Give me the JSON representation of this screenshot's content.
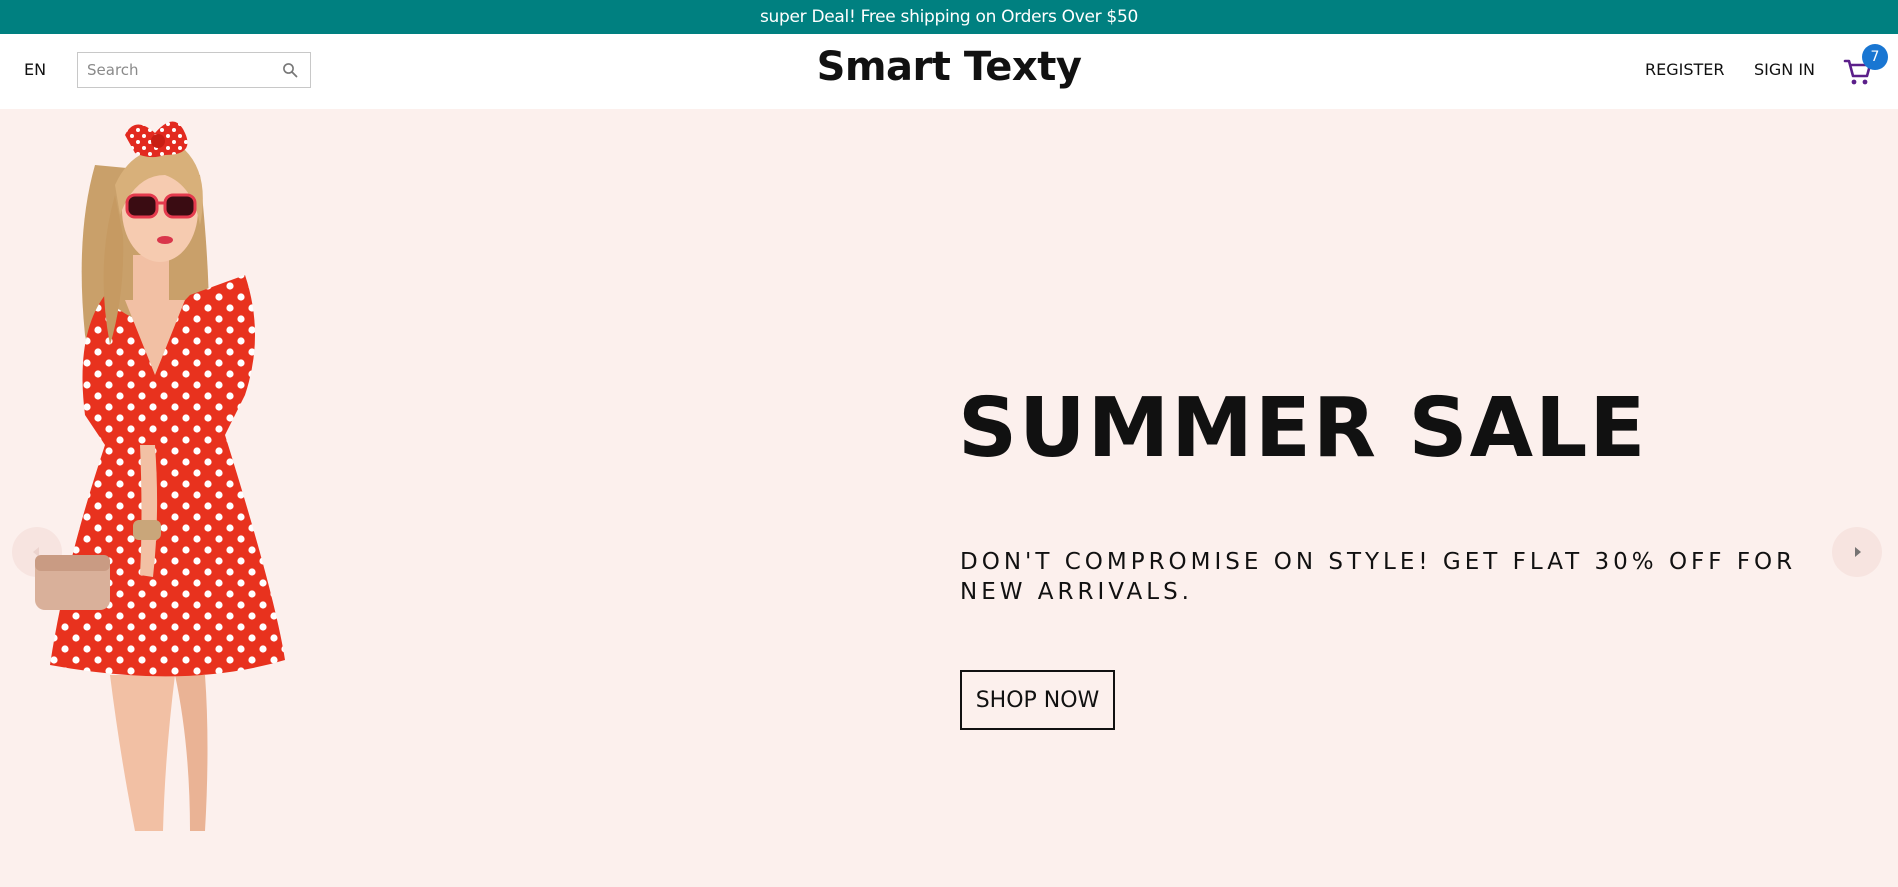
{
  "announcement": {
    "text": "super Deal! Free shipping on Orders Over $50"
  },
  "navbar": {
    "language": "EN",
    "search": {
      "placeholder": "Search",
      "value": "",
      "icon": "search-icon"
    },
    "logo": "Smart Texty",
    "register_label": "REGISTER",
    "signin_label": "SIGN IN",
    "cart": {
      "icon": "shopping-cart-icon",
      "count": "7"
    }
  },
  "hero": {
    "title": "SUMMER SALE",
    "description": "DON'T COMPROMISE ON STYLE! GET FLAT 30% OFF FOR NEW ARRIVALS.",
    "button_label": "SHOP NOW",
    "left_arrow_icon": "arrow-left-icon",
    "right_arrow_icon": "arrow-right-icon"
  },
  "colors": {
    "announcement_bg": "#008080",
    "hero_bg": "#fcf0ed",
    "badge": "#1976d2",
    "cart_icon": "#5b1f8a",
    "dress": "#e8321e"
  }
}
